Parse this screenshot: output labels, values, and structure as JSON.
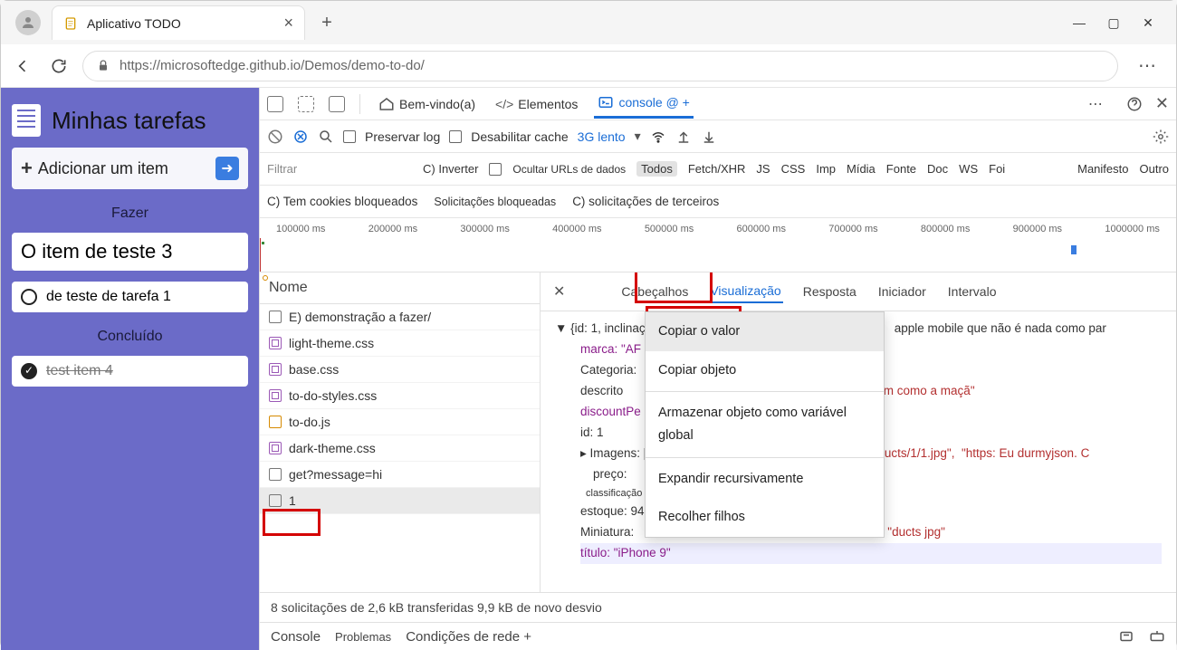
{
  "browser": {
    "tab_title": "Aplicativo TODO",
    "url": "https://microsoftedge.github.io/Demos/demo-to-do/"
  },
  "app": {
    "title": "Minhas tarefas",
    "add_label": "Adicionar um item",
    "section_todo": "Fazer",
    "section_done": "Concluído",
    "tasks_todo": [
      "O item de teste 3",
      "de teste de tarefa 1"
    ],
    "tasks_done": [
      "test item 4"
    ]
  },
  "devtools": {
    "tabs": {
      "welcome": "Bem-vindo(a)",
      "elements": "Elementos",
      "console": "console @ +"
    },
    "toolbar": {
      "preserve_log": "Preservar log",
      "disable_cache": "Desabilitar cache",
      "throttle": "3G lento"
    },
    "filterbar": {
      "filter": "Filtrar",
      "invert": "C) Inverter",
      "hide_urls": "Ocultar URLs de dados",
      "todos": "Todos",
      "types": [
        "Fetch/XHR",
        "JS",
        "CSS",
        "Imp",
        "Mídia",
        "Fonte",
        "Doc",
        "WS",
        "Foi",
        "Manifesto",
        "Outro"
      ]
    },
    "checks": {
      "blocked_cookies": "C) Tem cookies bloqueados",
      "blocked_req": "Solicitações bloqueadas",
      "third_party": "C) solicitações de terceiros"
    },
    "timeline": [
      "100000 ms",
      "200000 ms",
      "300000 ms",
      "400000 ms",
      "500000 ms",
      "600000 ms",
      "700000 ms",
      "800000 ms",
      "900000 ms",
      "1000000 ms"
    ],
    "name_col": "Nome",
    "requests": [
      {
        "label": "E) demonstração a fazer/",
        "icon": "doc"
      },
      {
        "label": "light-theme.css",
        "icon": "css"
      },
      {
        "label": "base.css",
        "icon": "css"
      },
      {
        "label": "to-do-styles.css",
        "icon": "css"
      },
      {
        "label": "to-do.js",
        "icon": "js"
      },
      {
        "label": "dark-theme.css",
        "icon": "css"
      },
      {
        "label": "get?message=hi",
        "icon": "doc"
      },
      {
        "label": "1",
        "icon": "doc",
        "selected": true
      }
    ],
    "detail_tabs": [
      "Cabeçalhos",
      "Visualização",
      "Resposta",
      "Iniciador",
      "Intervalo"
    ],
    "json_preview": {
      "line1": "{id: 1, inclinação",
      "line1b": "apple mobile que não é nada como par",
      "brand": "marca: \"AF",
      "cat": "Categoria:",
      "desc": "descrito",
      "desc_b": "em como a maçã\"",
      "discount": "discountPe",
      "id": "id: 1",
      "images": "Imagens: [\"",
      "images_b": "ducts/1/1.jpg\",",
      "images_c": "\"https: Eu durmyjson. C",
      "price": "preço:",
      "rating": "classificação 54E: 4.",
      "stock": "estoque: 94",
      "thumb": "Miniatura:",
      "thumb_b": "\"ducts jpg\"",
      "title": "título: \"iPhone 9\""
    },
    "context_menu": [
      "Copiar o valor",
      "Copiar objeto",
      "Armazenar objeto como variável global",
      "Expandir recursivamente",
      "Recolher filhos"
    ],
    "status": "8 solicitações de 2,6 kB transferidas 9,9 kB de novo desvio",
    "drawer": {
      "console": "Console",
      "problems": "Problemas",
      "network": "Condições de rede +"
    }
  }
}
